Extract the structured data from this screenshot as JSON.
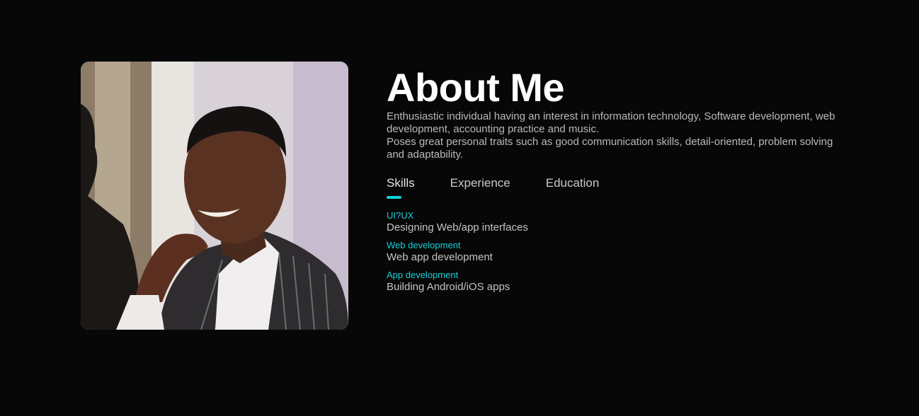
{
  "about": {
    "title": "About Me",
    "bio": [
      "Enthusiastic individual having an interest in information technology, Software development, web development, accounting practice and music.",
      "Poses great personal traits such as good communication skills, detail-oriented, problem solving and adaptability."
    ]
  },
  "tabs": [
    {
      "label": "Skills",
      "active": true
    },
    {
      "label": "Experience",
      "active": false
    },
    {
      "label": "Education",
      "active": false
    }
  ],
  "skills": [
    {
      "name": "UI?UX",
      "description": "Designing Web/app interfaces"
    },
    {
      "name": "Web development",
      "description": "Web app development"
    },
    {
      "name": "App development",
      "description": "Building Android/iOS apps"
    }
  ],
  "colors": {
    "background": "#070707",
    "accent": "#10d0d6",
    "title": "#ffffff",
    "text": "#b9b9b9"
  }
}
